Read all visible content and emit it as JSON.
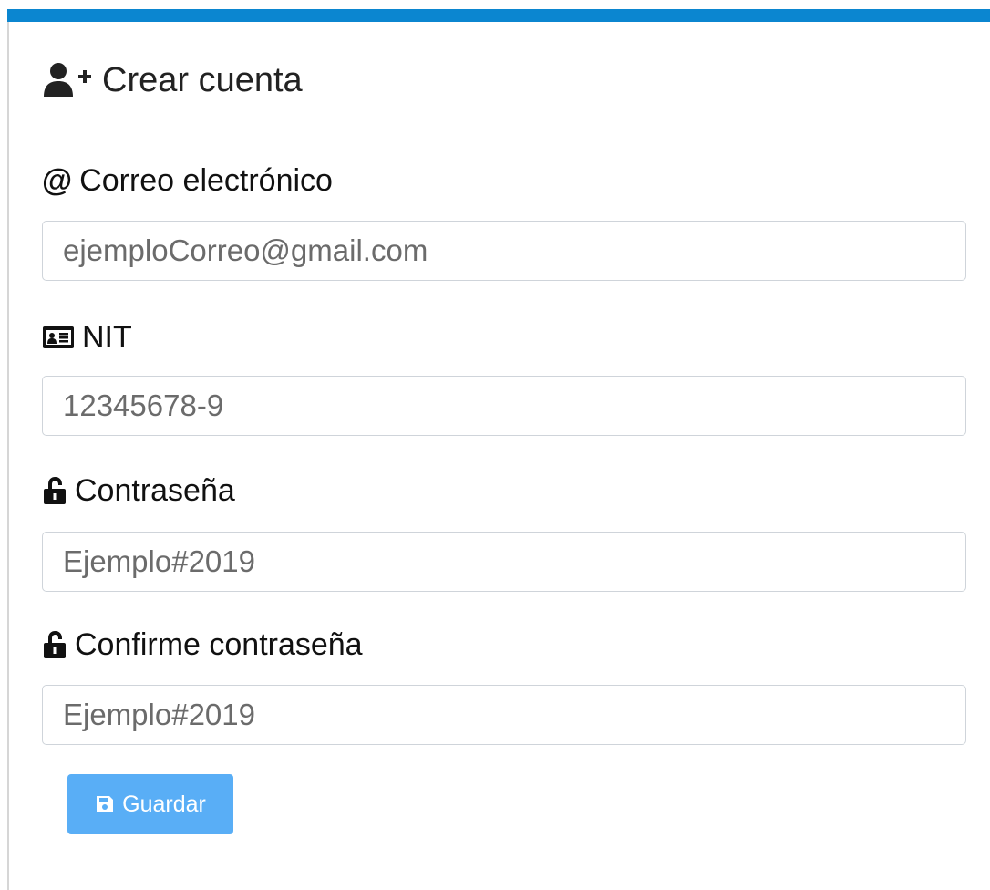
{
  "form": {
    "title": "Crear cuenta",
    "title_icon": "user-plus-icon",
    "fields": [
      {
        "label": "Correo electrónico",
        "icon": "at-icon",
        "icon_glyph": "@",
        "placeholder": "ejemploCorreo@gmail.com"
      },
      {
        "label": "NIT",
        "icon": "id-card-icon",
        "placeholder": "12345678-9"
      },
      {
        "label": "Contraseña",
        "icon": "unlock-icon",
        "placeholder": "Ejemplo#2019"
      },
      {
        "label": "Confirme contraseña",
        "icon": "unlock-icon",
        "placeholder": "Ejemplo#2019"
      }
    ],
    "submit": {
      "label": "Guardar",
      "icon": "save-icon"
    }
  },
  "colors": {
    "accent_bar": "#0b86d0",
    "button": "#59aef6",
    "input_border": "#cfd4da"
  }
}
